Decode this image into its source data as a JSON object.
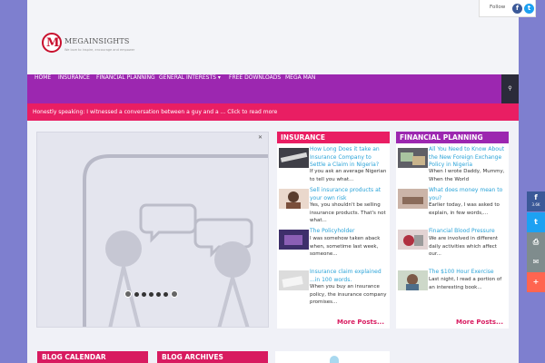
{
  "header": {
    "logo_letter": "M",
    "logo_name": "MEGAINSIGHTS",
    "logo_tagline": "We love to inspire, encourage and empower"
  },
  "follow": {
    "label": "Follow",
    "facebook": "f",
    "twitter": "t"
  },
  "nav": {
    "items": [
      "HOME",
      "INSURANCE",
      "FINANCIAL PLANNING",
      "GENERAL INTERESTS",
      "FREE DOWNLOADS",
      "MEGA MAN"
    ],
    "dropdown_caret": "▾",
    "search_icon": "search-icon",
    "colors": {
      "bar": "#9c27b0",
      "search": "#2b2b3a"
    }
  },
  "ticker": {
    "text": "Honestly speaking: I witnessed a conversation between a guy and a ... Click to read more",
    "color": "#e91e63"
  },
  "slider": {
    "close": "✕"
  },
  "insurance": {
    "title": "INSURANCE",
    "color": "#e91e63",
    "more": "More Posts...",
    "posts": [
      {
        "title": "How Long Does it take an Insurance Company to Settle a Claim in Nigeria?",
        "excerpt": "If you ask an average Nigerian to tell you what..."
      },
      {
        "title": "Sell insurance products at your own risk",
        "excerpt": "Yes, you shouldn't be selling insurance products. That's not what..."
      },
      {
        "title": "The Policyholder",
        "excerpt": "I was somehow taken aback when, sometime last week, someone..."
      },
      {
        "title": "Insurance claim explained ...in 100 words.",
        "excerpt": "When you buy an insurance policy, the insurance company promises..."
      }
    ]
  },
  "financial": {
    "title": "FINANCIAL PLANNING",
    "color": "#9c27b0",
    "more": "More Posts...",
    "posts": [
      {
        "title": "All You Need to Know About the New Foreign Exchange Policy in Nigeria",
        "excerpt": "When I wrote Daddy, Mummy, When the World"
      },
      {
        "title": "What does money mean to you?",
        "excerpt": "Earlier today, I was asked to explain, in few words,..."
      },
      {
        "title": "Financial Blood Pressure",
        "excerpt": "We are involved in different daily activities which affect our..."
      },
      {
        "title": "The $100 Hour Exercise",
        "excerpt": "Last night, I read a portion of an interesting book..."
      }
    ]
  },
  "share": {
    "facebook": "f",
    "facebook_count": "3.6K",
    "twitter": "t",
    "print": "⎙",
    "email": "✉",
    "more": "+",
    "colors": {
      "facebook": "#3b5998",
      "twitter": "#1da1f2",
      "print": "#7f8c8d",
      "email": "#7f8c8d",
      "more": "#ff6550"
    }
  },
  "bottom": {
    "calendar": "BLOG CALENDAR",
    "archives": "BLOG ARCHIVES"
  }
}
